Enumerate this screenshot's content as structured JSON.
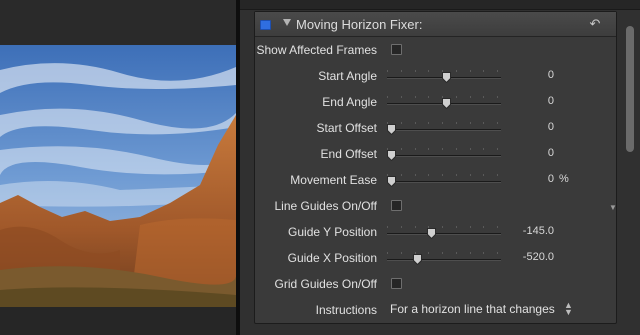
{
  "effect": {
    "title": "Moving Horizon Fixer:",
    "enabled": true
  },
  "params": [
    {
      "label": "Show Affected Frames",
      "kind": "checkbox",
      "checked": false
    },
    {
      "label": "Start Angle",
      "kind": "slider",
      "value": "0",
      "fraction": 0.5
    },
    {
      "label": "End Angle",
      "kind": "slider",
      "value": "0",
      "fraction": 0.5
    },
    {
      "label": "Start Offset",
      "kind": "slider",
      "value": "0",
      "fraction": 0.0
    },
    {
      "label": "End Offset",
      "kind": "slider",
      "value": "0",
      "fraction": 0.0
    },
    {
      "label": "Movement Ease",
      "kind": "slider",
      "value": "0",
      "unit": "%",
      "fraction": 0.0
    },
    {
      "label": "Line Guides On/Off",
      "kind": "checkbox",
      "checked": false
    },
    {
      "label": "Guide Y Position",
      "kind": "slider",
      "value": "-145.0",
      "fraction": 0.36
    },
    {
      "label": "Guide X Position",
      "kind": "slider",
      "value": "-520.0",
      "fraction": 0.24
    },
    {
      "label": "Grid Guides On/Off",
      "kind": "checkbox",
      "checked": false
    },
    {
      "label": "Instructions",
      "kind": "popup",
      "value": "For a horizon line that changes"
    }
  ],
  "icons": {
    "reset": "reset-arrow-icon",
    "disclosure": "disclosure-triangle-icon",
    "popup": "popup-arrows-icon"
  },
  "colors": {
    "enabled_checkbox": "#2f6ee0"
  }
}
